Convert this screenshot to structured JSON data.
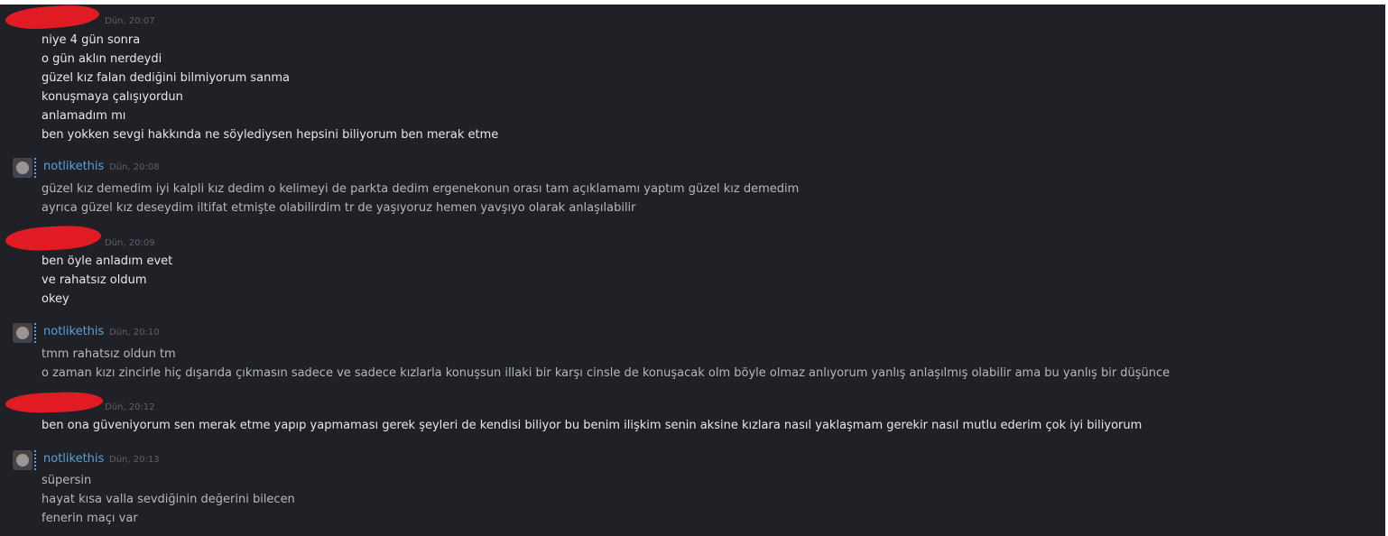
{
  "chat": {
    "messages": [
      {
        "author": "",
        "timestamp": "Dün, 20:07",
        "lines": [
          "niye 4 gün sonra",
          "o gün aklın nerdeydi",
          "güzel kız falan dediğini bilmiyorum sanma",
          "konuşmaya çalışıyordun",
          "anlamadım mı",
          "ben yokken sevgi hakkında ne söylediysen hepsini biliyorum ben merak etme"
        ]
      },
      {
        "author": "notlikethis",
        "timestamp": "Dün, 20:08",
        "lines": [
          "güzel kız demedim iyi kalpli kız dedim o kelimeyi de parkta dedim ergenekonun orası tam açıklamamı yaptım güzel kız demedim",
          "ayrıca güzel kız deseydim iltifat etmişte olabilirdim tr de yaşıyoruz hemen yavşıyo olarak anlaşılabilir"
        ]
      },
      {
        "author": "",
        "timestamp": "Dün, 20:09",
        "lines": [
          "ben öyle anladım evet",
          "ve rahatsız oldum",
          "okey"
        ]
      },
      {
        "author": "notlikethis",
        "timestamp": "Dün, 20:10",
        "lines": [
          "tmm rahatsız oldun tm",
          "o zaman kızı zincirle hiç dışarıda çıkmasın sadece ve sadece kızlarla konuşsun illaki bir karşı cinsle de konuşacak olm böyle olmaz anlıyorum yanlış anlaşılmış olabilir ama bu yanlış bir düşünce"
        ]
      },
      {
        "author": "",
        "timestamp": "Dün, 20:12",
        "lines": [
          "ben ona güveniyorum sen merak etme yapıp yapmaması gerek şeyleri de kendisi biliyor bu benim ilişkim senin aksine kızlara nasıl yaklaşmam gerekir nasıl mutlu ederim çok iyi biliyorum"
        ]
      },
      {
        "author": "notlikethis",
        "timestamp": "Dün, 20:13",
        "lines": [
          "süpersin",
          "hayat kısa valla sevdiğinin değerini bilecen",
          "fenerin maçı var"
        ]
      }
    ]
  },
  "colors": {
    "background": "#1f2126",
    "username": "#5aa0d8",
    "redaction": "#e01b24",
    "my_text": "#e6e8ea",
    "other_text": "#b4b8bd",
    "timestamp": "#5c6068"
  }
}
